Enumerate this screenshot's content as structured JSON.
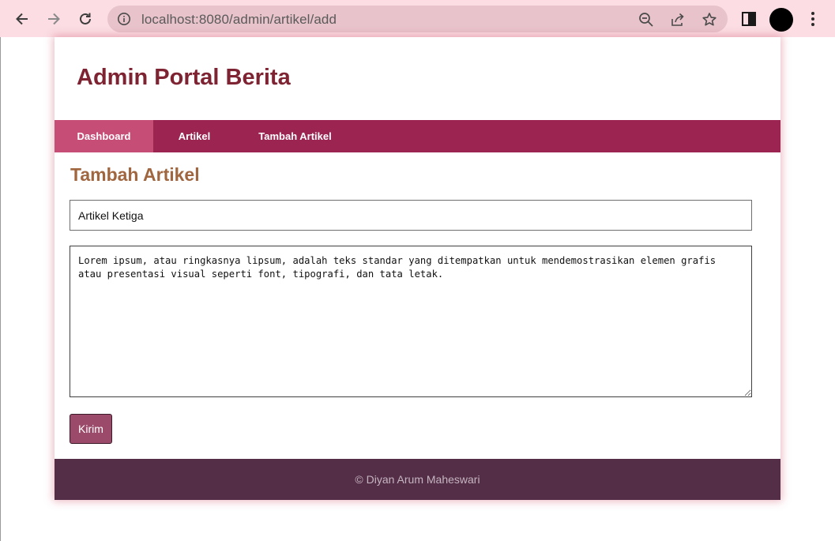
{
  "browser": {
    "url": "localhost:8080/admin/artikel/add"
  },
  "header": {
    "site_title": "Admin Portal Berita"
  },
  "nav": {
    "items": [
      {
        "label": "Dashboard"
      },
      {
        "label": "Artikel"
      },
      {
        "label": "Tambah Artikel"
      }
    ]
  },
  "form": {
    "heading": "Tambah Artikel",
    "title_value": "Artikel Ketiga",
    "content_value": "Lorem ipsum, atau ringkasnya lipsum, adalah teks standar yang ditempatkan untuk mendemostrasikan elemen grafis atau presentasi visual seperti font, tipografi, dan tata letak.",
    "submit_label": "Kirim"
  },
  "footer": {
    "text": "© Diyan Arum Maheswari"
  },
  "colors": {
    "browser_bar": "#fbdde3",
    "title": "#7e2332",
    "navbar": "#9b2450",
    "nav_active": "#c64d75",
    "heading": "#a0663f",
    "button": "#9c4a6a",
    "footer": "#542d47"
  },
  "icons": [
    "back-arrow-icon",
    "forward-arrow-icon",
    "reload-icon",
    "info-icon",
    "zoom-out-icon",
    "share-icon",
    "bookmark-star-icon",
    "side-panel-icon",
    "profile-avatar",
    "kebab-menu-icon"
  ]
}
